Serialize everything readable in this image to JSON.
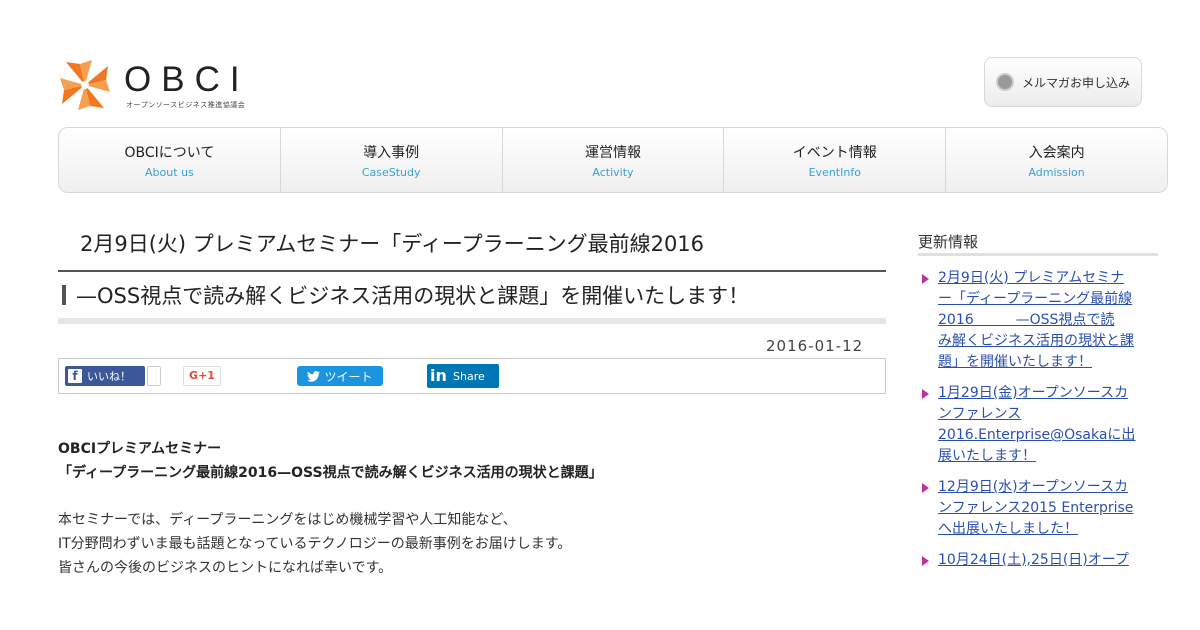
{
  "header": {
    "logo_text": "OBCI",
    "logo_sub": "オープンソースビジネス推進協議会",
    "mailmag_label": "メルマガお申し込み"
  },
  "nav": [
    {
      "jp": "OBCIについて",
      "en": "About us"
    },
    {
      "jp": "導入事例",
      "en": "CaseStudy"
    },
    {
      "jp": "運営情報",
      "en": "Activity"
    },
    {
      "jp": "イベント情報",
      "en": "EventInfo"
    },
    {
      "jp": "入会案内",
      "en": "Admission"
    }
  ],
  "article": {
    "title_line1": "2月9日(火) プレミアムセミナー「ディープラーニング最前線2016",
    "title_line2": "—OSS視点で読み解くビジネス活用の現状と課題」を開催いたします！",
    "date": "2016-01-12",
    "share": {
      "like": "いいね！",
      "gplus": "G+1",
      "tweet": "ツイート",
      "share": "Share"
    },
    "subhead_line1": "OBCIプレミアムセミナー",
    "subhead_line2": "「ディープラーニング最前線2016—OSS視点で読み解くビジネス活用の現状と課題」",
    "body_lines": [
      "本セミナーでは、ディープラーニングをはじめ機械学習や人工知能など、",
      "IT分野問わずいま最も話題となっているテクノロジーの最新事例をお届けします。",
      "皆さんの今後のビジネスのヒントになれば幸いです。"
    ]
  },
  "sidebar": {
    "title": "更新情報",
    "items": [
      {
        "lines": [
          "2月9日(火) プレミアムセミナ",
          "ー「ディープラーニング最前線",
          "2016　　　—OSS視点で読",
          "み解くビジネス活用の現状と課",
          "題」を開催いたします！"
        ]
      },
      {
        "lines": [
          "1月29日(金)オープンソースカ",
          "ンファレンス",
          "2016.Enterprise@Osakaに出",
          "展いたします！"
        ]
      },
      {
        "lines": [
          "12月9日(水)オープンソースカ",
          "ンファレンス2015 Enterprise",
          "へ出展いたしました！"
        ]
      },
      {
        "lines": [
          "10月24日(土),25日(日)オープ"
        ]
      }
    ]
  },
  "colors": {
    "logo_orange": "#f07820",
    "nav_en": "#3aa0d8",
    "link": "#2a4fb0",
    "arrow": "#c030a0",
    "facebook": "#3b5998",
    "twitter": "#1b95e0",
    "linkedin": "#0077b5"
  }
}
